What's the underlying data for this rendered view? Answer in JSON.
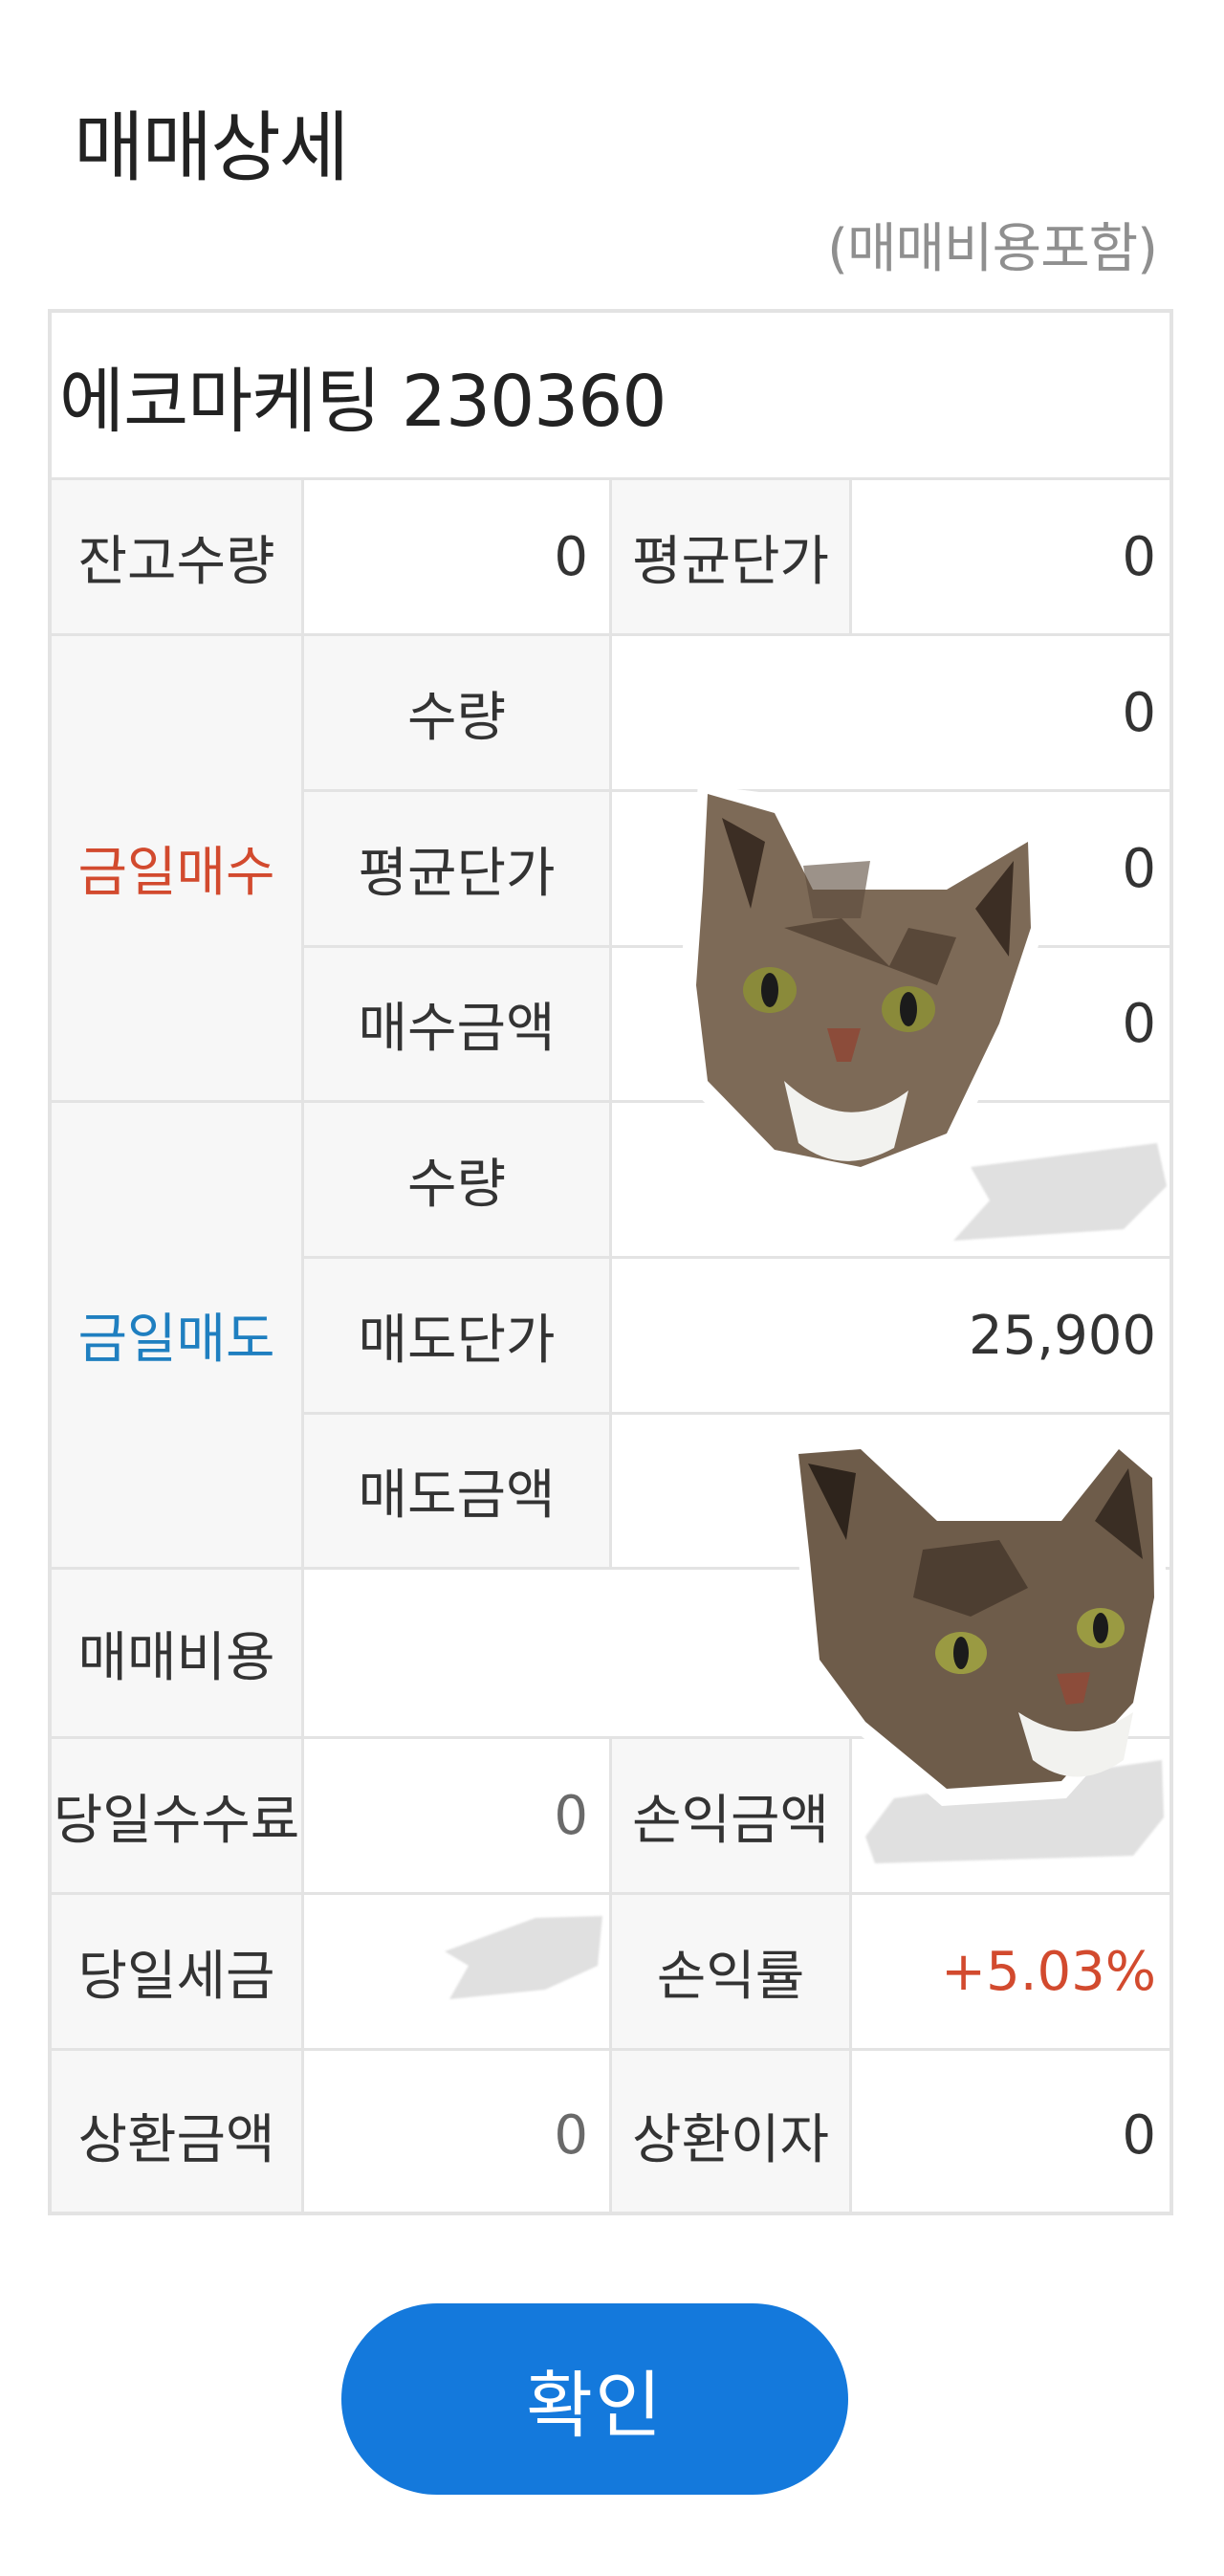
{
  "dialog": {
    "title": "매매상세",
    "note": "(매매비용포함)"
  },
  "stock": {
    "name_code": "에코마케팅 230360"
  },
  "rows": {
    "balance_qty_label": "잔고수량",
    "balance_qty_value": "0",
    "avg_price_label": "평균단가",
    "avg_price_value": "0"
  },
  "today_buy": {
    "section_label": "금일매수",
    "qty_label": "수량",
    "qty_value": "0",
    "avg_price_label": "평균단가",
    "avg_price_value": "0",
    "amount_label": "매수금액",
    "amount_value": "0"
  },
  "today_sell": {
    "section_label": "금일매도",
    "qty_label": "수량",
    "price_label": "매도단가",
    "price_value": "25,900",
    "amount_label": "매도금액"
  },
  "costs": {
    "trade_cost_label": "매매비용",
    "fee_label": "당일수수료",
    "fee_value": "0",
    "pl_amount_label": "손익금액",
    "tax_label": "당일세금",
    "pl_rate_label": "손익률",
    "pl_rate_value": "+5.03%",
    "repay_amount_label": "상환금액",
    "repay_amount_value": "0",
    "repay_interest_label": "상환이자",
    "repay_interest_value": "0"
  },
  "buttons": {
    "confirm_label": "확인"
  },
  "colors": {
    "buy_accent": "#d24a2e",
    "sell_accent": "#1f7fc0",
    "confirm_button": "#1479dc",
    "profit": "#d24a2e"
  }
}
